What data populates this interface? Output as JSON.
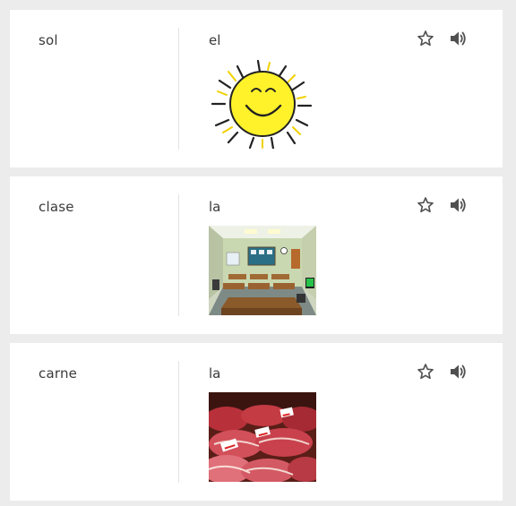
{
  "cards": [
    {
      "term": "sol",
      "article": "el",
      "image": "sun-illustration",
      "star_icon": "star-outline-icon",
      "sound_icon": "speaker-icon"
    },
    {
      "term": "clase",
      "article": "la",
      "image": "classroom-illustration",
      "star_icon": "star-outline-icon",
      "sound_icon": "speaker-icon"
    },
    {
      "term": "carne",
      "article": "la",
      "image": "meat-photo",
      "star_icon": "star-outline-icon",
      "sound_icon": "speaker-icon"
    }
  ],
  "colors": {
    "background": "#ececec",
    "card": "#ffffff",
    "text": "#3a3a3a",
    "icon": "#505050"
  }
}
